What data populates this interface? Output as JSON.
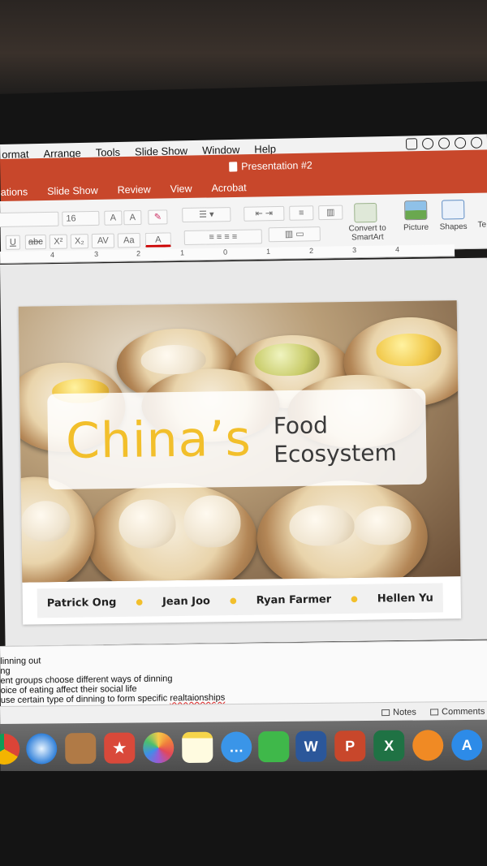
{
  "menubar": {
    "items": [
      "ormat",
      "Arrange",
      "Tools",
      "Slide Show",
      "Window",
      "Help"
    ]
  },
  "titlebar": {
    "document_title": "Presentation #2",
    "tabs": [
      "ations",
      "Slide Show",
      "Review",
      "View",
      "Acrobat"
    ]
  },
  "ribbon": {
    "font_size": "16",
    "convert_label": "Convert to SmartArt",
    "picture_label": "Picture",
    "shapes_label": "Shapes",
    "textbox_label_partial": "Te B",
    "strikethrough_label": "abc",
    "underline_label": "U"
  },
  "ruler": {
    "ticks": [
      "4",
      "3",
      "2",
      "1",
      "0",
      "1",
      "2",
      "3",
      "4"
    ]
  },
  "slide": {
    "title_main": "China’s",
    "title_sub_line1": "Food",
    "title_sub_line2": "Ecosystem",
    "authors": [
      "Patrick Ong",
      "Jean Joo",
      "Ryan Farmer",
      "Hellen Yu"
    ]
  },
  "notes": {
    "lines": [
      "linning out",
      "ng",
      "ent groups choose different ways of dinning",
      "oice of eating affect their social life",
      "use certain type of dinning to form specific "
    ],
    "misspelled_word": "realtaionships"
  },
  "statusbar": {
    "notes_label": "Notes",
    "comments_label": "Comments"
  },
  "dock": {
    "apps": [
      "chrome-icon",
      "safari-icon",
      "contacts-icon",
      "wunderlist-icon",
      "photos-icon",
      "notes-icon",
      "messages-icon",
      "facetime-icon",
      "word-icon",
      "powerpoint-icon",
      "excel-icon",
      "ibooks-icon",
      "app-store-icon"
    ],
    "word_letter": "W",
    "powerpoint_letter": "P",
    "excel_letter": "X"
  },
  "colors": {
    "powerpoint_accent": "#c8472b",
    "title_yellow": "#f2bf2b"
  }
}
